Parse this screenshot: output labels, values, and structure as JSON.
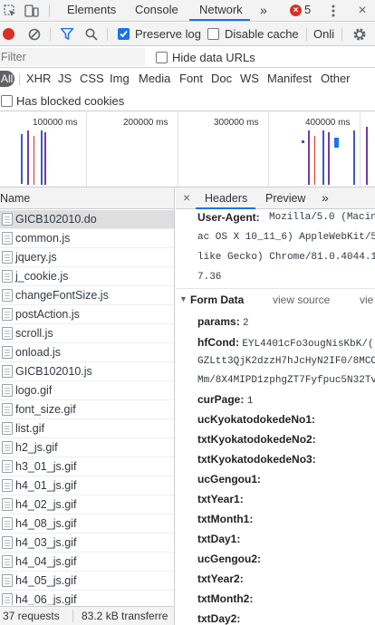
{
  "devtools_tabs": {
    "elements": "Elements",
    "console": "Console",
    "network": "Network",
    "more": "»",
    "error_count": "5"
  },
  "toolbar": {
    "preserve_log": "Preserve log",
    "disable_cache": "Disable cache",
    "throttle": "Onli"
  },
  "filter": {
    "placeholder": "Filter",
    "hide_data_urls": "Hide data URLs"
  },
  "type_filters": [
    "All",
    "XHR",
    "JS",
    "CSS",
    "Img",
    "Media",
    "Font",
    "Doc",
    "WS",
    "Manifest",
    "Other"
  ],
  "blocked_cookies": "Has blocked cookies",
  "timeline": {
    "ticks": [
      "100000 ms",
      "200000 ms",
      "300000 ms",
      "400000 ms"
    ]
  },
  "list": {
    "header": "Name",
    "requests": [
      "GICB102010.do",
      "common.js",
      "jquery.js",
      "j_cookie.js",
      "changeFontSize.js",
      "postAction.js",
      "scroll.js",
      "onload.js",
      "GICB102010.js",
      "logo.gif",
      "font_size.gif",
      "list.gif",
      "h2_js.gif",
      "h3_01_js.gif",
      "h4_01_js.gif",
      "h4_02_js.gif",
      "h4_08_js.gif",
      "h4_03_js.gif",
      "h4_04_js.gif",
      "h4_05_js.gif",
      "h4_06_js.gif"
    ]
  },
  "detail_tabs": {
    "close": "×",
    "headers": "Headers",
    "preview": "Preview",
    "more": "»"
  },
  "user_agent": {
    "label": "User-Agent:",
    "lines": [
      "Mozilla/5.0 (Macin",
      "ac OS X 10_11_6) AppleWebKit/5",
      "like Gecko) Chrome/81.0.4044.1",
      "7.36"
    ]
  },
  "form_data": {
    "title": "Form Data",
    "view_source": "view source",
    "view_more": "vie"
  },
  "params": [
    {
      "key": "params:",
      "value": "2"
    },
    {
      "key": "hfCond:",
      "value": "EYL4401cFo3ougNisKbK/("
    },
    {
      "key": "",
      "value": "GZLtt3QjK2dzzH7hJcHyN2IF0/8MCO"
    },
    {
      "key": "",
      "value": "Mm/8X4MIPD1zphgZT7Fyfpuc5N32Tv"
    },
    {
      "key": "curPage:",
      "value": "1"
    },
    {
      "key": "ucKyokatodokedeNo1:",
      "value": ""
    },
    {
      "key": "txtKyokatodokedeNo2:",
      "value": ""
    },
    {
      "key": "txtKyokatodokedeNo3:",
      "value": ""
    },
    {
      "key": "ucGengou1:",
      "value": ""
    },
    {
      "key": "txtYear1:",
      "value": ""
    },
    {
      "key": "txtMonth1:",
      "value": ""
    },
    {
      "key": "txtDay1:",
      "value": ""
    },
    {
      "key": "ucGengou2:",
      "value": ""
    },
    {
      "key": "txtYear2:",
      "value": ""
    },
    {
      "key": "txtMonth2:",
      "value": ""
    },
    {
      "key": "txtDay2:",
      "value": ""
    }
  ],
  "status": {
    "requests": "37 requests",
    "transferred": "83.2 kB transferre"
  },
  "colors": {
    "accent": "#1a73e8",
    "record": "#d93025",
    "error": "#d93025"
  }
}
